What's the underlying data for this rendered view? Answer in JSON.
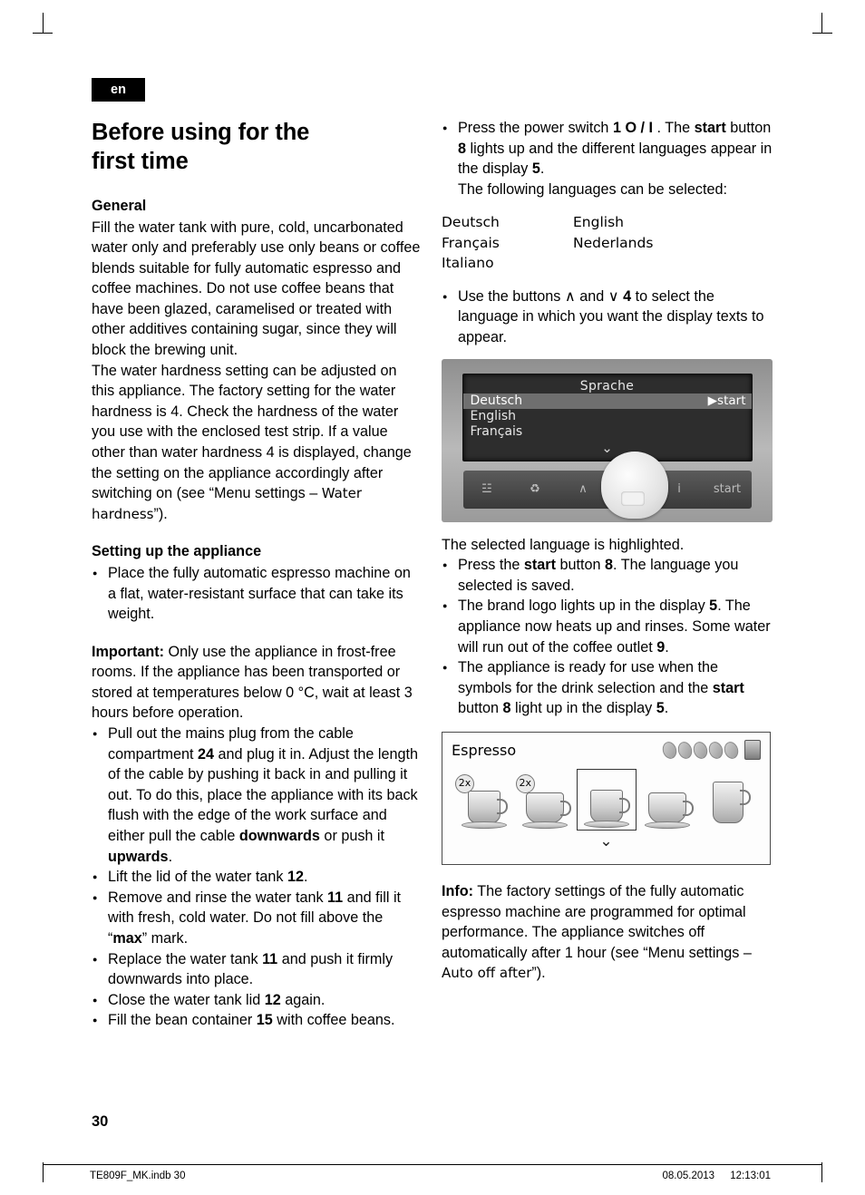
{
  "language_tag": "en",
  "title_line1": "Before using for the",
  "title_line2": "first time",
  "left": {
    "general_heading": "General",
    "general_text": "Fill the water tank with pure, cold, uncarbonated water only and preferably use only beans or coffee blends suitable for fully automatic espresso and coffee machines. Do not use coffee beans that have been glazed, caramelised or treated with other additives containing sugar, since they will block the brewing unit.\nThe water hardness setting can be adjusted on this appliance. The factory setting for the water hardness is 4. Check the hardness of the water you use with the enclosed test strip. If a value other than water hardness 4 is displayed, change the setting on the appliance accordingly after switching on (see “Menu settings – Water hardness”).",
    "setting_heading": "Setting up the appliance",
    "setting_bullet": "Place the fully automatic espresso machine on a flat, water-resistant surface that can take its weight.",
    "important_label": "Important:",
    "important_text": " Only use the appliance in frost-free rooms. If the appliance has been transported or stored at temperatures below 0 °C, wait at least 3 hours before operation.",
    "bullets": [
      "Pull out the mains plug from the cable compartment 24 and plug it in. Adjust the length of the cable by pushing it back in and pulling it out. To do this, place the appliance with its back flush with the edge of the work surface and either pull the cable downwards or push it upwards.",
      "Lift the lid of the water tank 12.",
      "Remove and rinse the water tank 11 and fill it with fresh, cold water. Do not fill above the “max” mark.",
      "Replace the water tank 11 and push it firmly downwards into place.",
      "Close the water tank lid 12 again.",
      "Fill the bean container 15 with coffee beans."
    ]
  },
  "right": {
    "bullet1": "Press the power switch 1 O / I . The start button 8 lights up and the different languages appear in the display 5. The following languages can be selected:",
    "languages": [
      {
        "col1": "Deutsch",
        "col2": "English"
      },
      {
        "col1": "Français",
        "col2": "Nederlands"
      },
      {
        "col1": "Italiano",
        "col2": ""
      }
    ],
    "bullet2": "Use the buttons ∧ and ∨ 4 to select the language in which you want the display texts to appear.",
    "display1": {
      "title": "Sprache",
      "rows": [
        "Deutsch",
        "English",
        "Français"
      ],
      "start_label": "start",
      "start_arrow": "▶",
      "chevron": "⌄",
      "buttons": [
        "☳",
        "♻",
        "∧",
        "∨",
        "i",
        "start"
      ]
    },
    "after_display_text": "The selected language is highlighted.",
    "bullets": [
      "Press the start button 8. The language you selected is saved.",
      "The brand logo lights up in the display 5. The appliance now heats up and rinses. Some water will run out of the coffee outlet 9.",
      "The appliance is ready for use when the symbols for the drink selection and the start button 8 light up in the display 5."
    ],
    "display2": {
      "title": "Espresso",
      "bean_count": 5,
      "two_x_label": "2x",
      "chevron": "⌄"
    },
    "info_label": "Info:",
    "info_text": " The factory settings of the fully automatic espresso machine are programmed for optimal performance. The appliance switches off automatically after 1 hour (see “Menu settings – Auto off after”)."
  },
  "footer": {
    "page_number": "30",
    "file_name": "TE809F_MK.indb   30",
    "date": "08.05.2013",
    "time": "12:13:01"
  }
}
